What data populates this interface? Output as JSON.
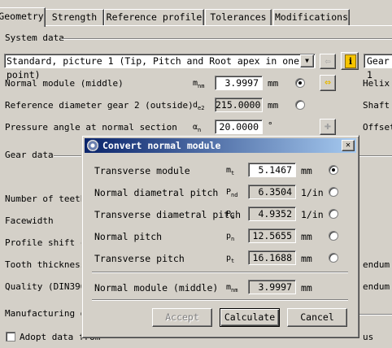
{
  "tabs": [
    {
      "label": "Geometry",
      "active": true
    },
    {
      "label": "Strength"
    },
    {
      "label": "Reference profile"
    },
    {
      "label": "Tolerances"
    },
    {
      "label": "Modifications"
    }
  ],
  "system_data": {
    "section_label": "System data",
    "combo_value": "Standard, picture 1 (Tip, Pitch and Root apex in one point)",
    "right_combo_value": "Gear 1",
    "rows": [
      {
        "label": "Normal module (middle)",
        "symbol": "m",
        "sub": "nm",
        "value": "3.9997",
        "unit": "mm",
        "right_label": "Helix"
      },
      {
        "label": "Reference diameter gear 2 (outside)",
        "symbol": "d",
        "sub": "e2",
        "value": "215.0000",
        "unit": "mm",
        "right_label": "Shaft"
      },
      {
        "label": "Pressure angle at normal section",
        "symbol": "α",
        "sub": "n",
        "value": "20.0000",
        "unit": "°",
        "right_label": "Offset"
      }
    ]
  },
  "gear_data": {
    "section_label": "Gear data",
    "rows": [
      {
        "label": "Number of teeth"
      },
      {
        "label": "Facewidth"
      },
      {
        "label": "Profile shift co"
      },
      {
        "label": "Tooth thickness",
        "right": "endum c"
      },
      {
        "label": "Quality (DIN3965",
        "right": "endum c"
      }
    ]
  },
  "manufacturing": {
    "section_label": "Manufacturing da",
    "checkbox_label": "Adopt data from",
    "checkbox_right": "us"
  },
  "dialog": {
    "title": "Convert normal module",
    "close_glyph": "✕",
    "rows": [
      {
        "label": "Transverse module",
        "symbol": "m",
        "sub": "t",
        "value": "5.1467",
        "unit": "mm",
        "editable": true,
        "selected": true
      },
      {
        "label": "Normal diametral pitch",
        "symbol": "P",
        "sub": "nd",
        "value": "6.3504",
        "unit": "1/in",
        "editable": false,
        "selected": false
      },
      {
        "label": "Transverse diametral pitch",
        "symbol": "P",
        "sub": "d",
        "value": "4.9352",
        "unit": "1/in",
        "editable": false,
        "selected": false
      },
      {
        "label": "Normal pitch",
        "symbol": "p",
        "sub": "n",
        "value": "12.5655",
        "unit": "mm",
        "editable": false,
        "selected": false
      },
      {
        "label": "Transverse pitch",
        "symbol": "p",
        "sub": "t",
        "value": "16.1688",
        "unit": "mm",
        "editable": false,
        "selected": false
      }
    ],
    "result": {
      "label": "Normal module (middle)",
      "symbol": "m",
      "sub": "nm",
      "value": "3.9997",
      "unit": "mm"
    },
    "buttons": {
      "accept": "Accept",
      "calculate": "Calculate",
      "cancel": "Cancel"
    }
  }
}
